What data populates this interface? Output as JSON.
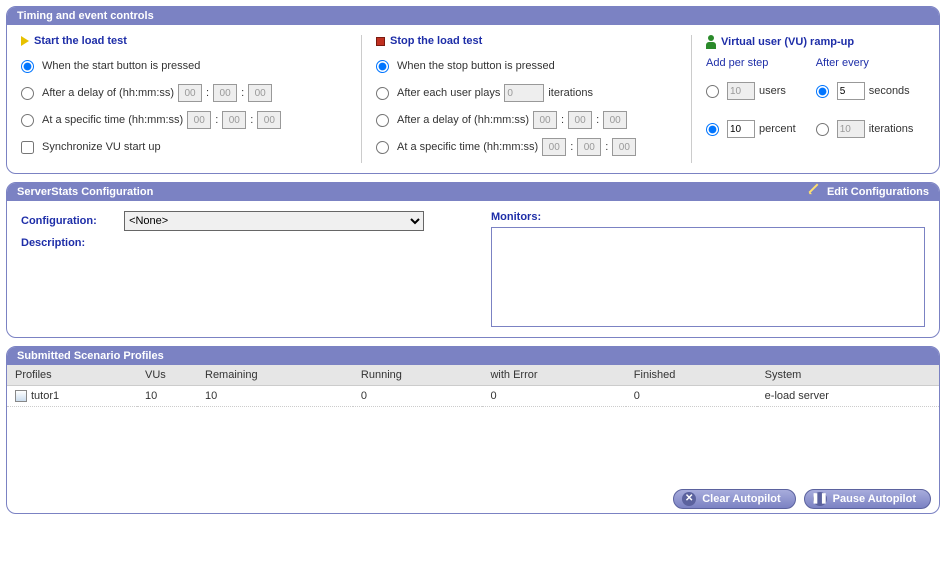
{
  "timing": {
    "title": "Timing and event controls",
    "start": {
      "title": "Start the load test",
      "opt_pressed": "When the start button is pressed",
      "opt_delay": "After a delay of (hh:mm:ss)",
      "delay_h": "00",
      "delay_m": "00",
      "delay_s": "00",
      "opt_specific": "At a specific time (hh:mm:ss)",
      "spec_h": "00",
      "spec_m": "00",
      "spec_s": "00",
      "sync_label": "Synchronize VU start up"
    },
    "stop": {
      "title": "Stop the load test",
      "opt_pressed": "When the stop button is pressed",
      "opt_plays_pre": "After each user plays",
      "opt_plays_post": "iterations",
      "plays_val": "0",
      "opt_delay": "After a delay of (hh:mm:ss)",
      "delay_h": "00",
      "delay_m": "00",
      "delay_s": "00",
      "opt_specific": "At a specific time (hh:mm:ss)",
      "spec_h": "00",
      "spec_m": "00",
      "spec_s": "00"
    },
    "ramp": {
      "title": "Virtual user (VU) ramp-up",
      "col_add": "Add per step",
      "col_every": "After every",
      "users_val": "10",
      "users_unit": "users",
      "seconds_val": "5",
      "seconds_unit": "seconds",
      "percent_val": "10",
      "percent_unit": "percent",
      "iter_val": "10",
      "iter_unit": "iterations"
    }
  },
  "serverstats": {
    "title": "ServerStats Configuration",
    "edit_label": "Edit Configurations",
    "config_label": "Configuration:",
    "config_value": "<None>",
    "desc_label": "Description:",
    "monitors_label": "Monitors:"
  },
  "profiles": {
    "title": "Submitted Scenario Profiles",
    "headers": {
      "profiles": "Profiles",
      "vus": "VUs",
      "remaining": "Remaining",
      "running": "Running",
      "with_error": "with Error",
      "finished": "Finished",
      "system": "System"
    },
    "rows": [
      {
        "name": "tutor1",
        "vus": "10",
        "remaining": "10",
        "running": "0",
        "with_error": "0",
        "finished": "0",
        "system": "e-load server"
      }
    ],
    "clear_btn": "Clear Autopilot",
    "pause_btn": "Pause Autopilot"
  }
}
